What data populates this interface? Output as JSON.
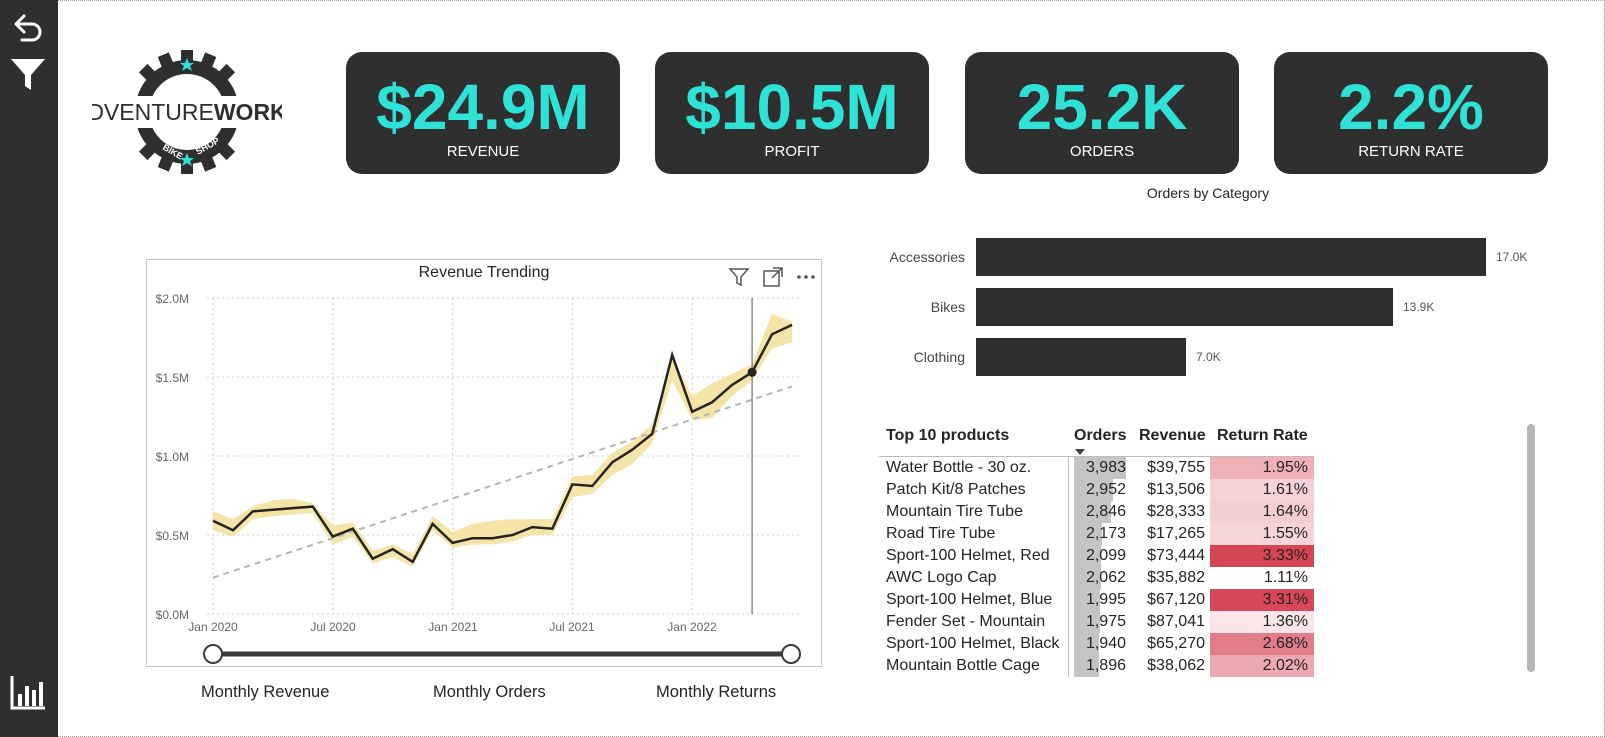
{
  "brand": {
    "logo_text_left": "ADVENTURE",
    "logo_text_right": "WORKS",
    "logo_sub_left": "BIKE",
    "logo_sub_right": "SHOP",
    "accent_color": "#2ee3d6",
    "dark_color": "#2f2f2f"
  },
  "rail": {
    "icons": [
      "back-arrow-icon",
      "filter-icon",
      "bar-chart-icon"
    ]
  },
  "kpis": [
    {
      "value": "$24.9M",
      "label": "REVENUE"
    },
    {
      "value": "$10.5M",
      "label": "PROFIT"
    },
    {
      "value": "25.2K",
      "label": "ORDERS"
    },
    {
      "value": "2.2%",
      "label": "RETURN RATE"
    }
  ],
  "revenue_chart": {
    "title": "Revenue Trending",
    "header_icons": [
      "filter-icon",
      "focus-mode-icon",
      "more-options-icon"
    ],
    "y_ticks": [
      "$2.0M",
      "$1.5M",
      "$1.0M",
      "$0.5M",
      "$0.0M"
    ],
    "x_ticks": [
      "Jan 2020",
      "Jul 2020",
      "Jan 2021",
      "Jul 2021",
      "Jan 2022"
    ]
  },
  "chart_data": [
    {
      "type": "line",
      "title": "Revenue Trending",
      "xlabel": "",
      "ylabel": "",
      "x_range": [
        "2020-01",
        "2022-06"
      ],
      "ylim": [
        0,
        2000000
      ],
      "grid": true,
      "x": [
        "2020-01",
        "2020-02",
        "2020-03",
        "2020-04",
        "2020-05",
        "2020-06",
        "2020-07",
        "2020-08",
        "2020-09",
        "2020-10",
        "2020-11",
        "2020-12",
        "2021-01",
        "2021-02",
        "2021-03",
        "2021-04",
        "2021-05",
        "2021-06",
        "2021-07",
        "2021-08",
        "2021-09",
        "2021-10",
        "2021-11",
        "2021-12",
        "2022-01",
        "2022-02",
        "2022-03",
        "2022-04",
        "2022-05",
        "2022-06"
      ],
      "series": [
        {
          "values": [
            590000,
            530000,
            650000,
            660000,
            670000,
            680000,
            490000,
            540000,
            350000,
            410000,
            330000,
            570000,
            450000,
            480000,
            480000,
            500000,
            550000,
            540000,
            820000,
            810000,
            960000,
            1040000,
            1140000,
            1640000,
            1280000,
            1340000,
            1450000,
            1530000,
            1770000,
            1830000
          ]
        },
        {
          "values": [
            230000,
            270000,
            320000,
            360000,
            400000,
            440000,
            480000,
            520000,
            560000,
            600000,
            640000,
            680000,
            720000,
            760000,
            800000,
            840000,
            880000,
            920000,
            960000,
            1000000,
            1040000,
            1080000,
            1120000,
            1160000,
            1200000,
            1240000,
            1280000,
            1320000,
            1360000,
            1440000
          ]
        }
      ],
      "band": {
        "upper": [
          650000,
          600000,
          680000,
          720000,
          730000,
          700000,
          560000,
          580000,
          400000,
          440000,
          380000,
          620000,
          520000,
          570000,
          590000,
          600000,
          600000,
          600000,
          870000,
          880000,
          1020000,
          1090000,
          1200000,
          1620000,
          1380000,
          1460000,
          1520000,
          1580000,
          1900000,
          1850000
        ],
        "lower": [
          530000,
          490000,
          600000,
          620000,
          630000,
          640000,
          440000,
          490000,
          320000,
          360000,
          300000,
          530000,
          420000,
          440000,
          440000,
          460000,
          500000,
          500000,
          740000,
          760000,
          880000,
          950000,
          1080000,
          1480000,
          1230000,
          1240000,
          1380000,
          1480000,
          1680000,
          1720000
        ]
      }
    },
    {
      "type": "bar",
      "title": "Orders by Category",
      "categories": [
        "Accessories",
        "Bikes",
        "Clothing"
      ],
      "values": [
        17000,
        13900,
        7000
      ],
      "data_labels": [
        "17.0K",
        "13.9K",
        "7.0K"
      ],
      "xlabel": "",
      "ylabel": ""
    }
  ],
  "tabs": [
    {
      "label": "Monthly Revenue"
    },
    {
      "label": "Monthly Orders"
    },
    {
      "label": "Monthly Returns"
    }
  ],
  "top_products": {
    "headers": {
      "product": "Top 10 products",
      "orders": "Orders",
      "revenue": "Revenue",
      "return_rate": "Return Rate"
    },
    "sort_icon": "sort-descending-icon",
    "rows": [
      {
        "product": "Water Bottle - 30 oz.",
        "orders": "3,983",
        "orders_num": 3983,
        "revenue": "$39,755",
        "return_rate": "1.95%",
        "rr_color": "#efb1b6"
      },
      {
        "product": "Patch Kit/8 Patches",
        "orders": "2,952",
        "orders_num": 2952,
        "revenue": "$13,506",
        "return_rate": "1.61%",
        "rr_color": "#f5d2d5"
      },
      {
        "product": "Mountain Tire Tube",
        "orders": "2,846",
        "orders_num": 2846,
        "revenue": "$28,333",
        "return_rate": "1.64%",
        "rr_color": "#f4cfd2"
      },
      {
        "product": "Road Tire Tube",
        "orders": "2,173",
        "orders_num": 2173,
        "revenue": "$17,265",
        "return_rate": "1.55%",
        "rr_color": "#f5d5d8"
      },
      {
        "product": "Sport-100 Helmet, Red",
        "orders": "2,099",
        "orders_num": 2099,
        "revenue": "$73,444",
        "return_rate": "3.33%",
        "rr_color": "#d64553"
      },
      {
        "product": "AWC Logo Cap",
        "orders": "2,062",
        "orders_num": 2062,
        "revenue": "$35,882",
        "return_rate": "1.11%",
        "rr_color": "#ffffff"
      },
      {
        "product": "Sport-100 Helmet, Blue",
        "orders": "1,995",
        "orders_num": 1995,
        "revenue": "$67,120",
        "return_rate": "3.31%",
        "rr_color": "#d7485a"
      },
      {
        "product": "Fender Set - Mountain",
        "orders": "1,975",
        "orders_num": 1975,
        "revenue": "$87,041",
        "return_rate": "1.36%",
        "rr_color": "#fae6e8"
      },
      {
        "product": "Sport-100 Helmet, Black",
        "orders": "1,940",
        "orders_num": 1940,
        "revenue": "$65,270",
        "return_rate": "2.68%",
        "rr_color": "#e27c88"
      },
      {
        "product": "Mountain Bottle Cage",
        "orders": "1,896",
        "orders_num": 1896,
        "revenue": "$38,062",
        "return_rate": "2.02%",
        "rr_color": "#eda9b0"
      }
    ]
  }
}
